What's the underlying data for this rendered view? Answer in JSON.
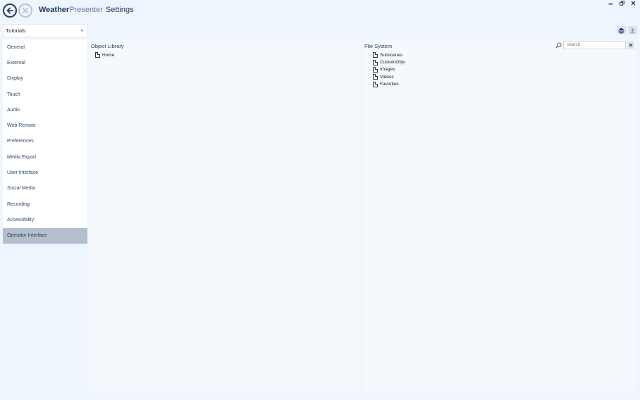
{
  "titlebar": {
    "brand_bold": "Weather",
    "brand_light": "Presenter",
    "title": "Settings",
    "minimize_icon": "minimize-icon",
    "restore_icon": "restore-icon",
    "close_icon": "close-icon"
  },
  "left_panel": {
    "dropdown_value": "Tutorials",
    "nav_items": [
      {
        "label": "General",
        "active": false
      },
      {
        "label": "External",
        "active": false
      },
      {
        "label": "Display",
        "active": false
      },
      {
        "label": "Touch",
        "active": false
      },
      {
        "label": "Audio",
        "active": false
      },
      {
        "label": "Web Remote",
        "active": false
      },
      {
        "label": "Preferences",
        "active": false
      },
      {
        "label": "Media Export",
        "active": false
      },
      {
        "label": "User Interface",
        "active": false
      },
      {
        "label": "Social Media",
        "active": false
      },
      {
        "label": "Recording",
        "active": false
      },
      {
        "label": "Accessibility",
        "active": false
      },
      {
        "label": "Operator Interface",
        "active": true
      }
    ]
  },
  "object_library": {
    "header": "Object Library",
    "items": [
      {
        "label": "Home"
      }
    ]
  },
  "file_system": {
    "header": "File System",
    "search_placeholder": "Search",
    "items": [
      {
        "label": "Subscenes"
      },
      {
        "label": "CustomObjs"
      },
      {
        "label": "Images"
      },
      {
        "label": "Videos"
      },
      {
        "label": "Favorites"
      }
    ]
  }
}
